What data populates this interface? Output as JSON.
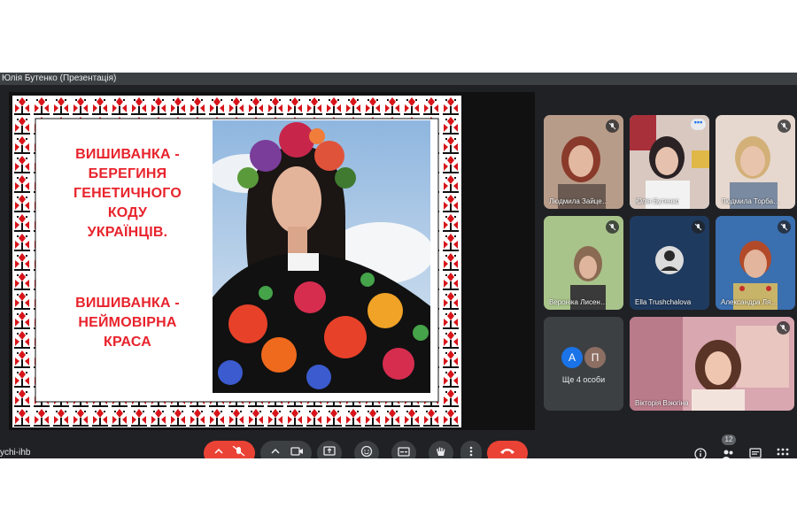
{
  "window": {
    "title": "Юлія Бутенко (Презентація)"
  },
  "meeting": {
    "code": "ychi-ihb"
  },
  "slide": {
    "line1": "ВИШИВАНКА  -",
    "line2": "БЕРЕГИНЯ",
    "line3": "ГЕНЕТИЧНОГО",
    "line4": "КОДУ",
    "line5": "УКРАЇНЦІВ.",
    "line6": "ВИШИВАНКА -",
    "line7": "НЕЙМОВІРНА",
    "line8": "КРАСА"
  },
  "participants": [
    {
      "name": "Людмила Зайце…",
      "muted": true
    },
    {
      "name": "Юлія Бутенко",
      "muted": false
    },
    {
      "name": "Людмила Торба…",
      "muted": true
    },
    {
      "name": "Вероніка Лисен…",
      "muted": true
    },
    {
      "name": "Ella Trushchalova",
      "muted": true
    },
    {
      "name": "Александра Ля…",
      "muted": true
    },
    {
      "name": "Вікторія Вэюгіна",
      "muted": true
    }
  ],
  "overflow": {
    "label": "Ще 4 особи",
    "avatar_a": "А",
    "avatar_b": "П"
  },
  "toolbar": {
    "people_count": "12"
  },
  "colors": {
    "accent_red": "#ea4335",
    "slide_text": "#e8232c",
    "tile_bg": "#3c4043"
  }
}
